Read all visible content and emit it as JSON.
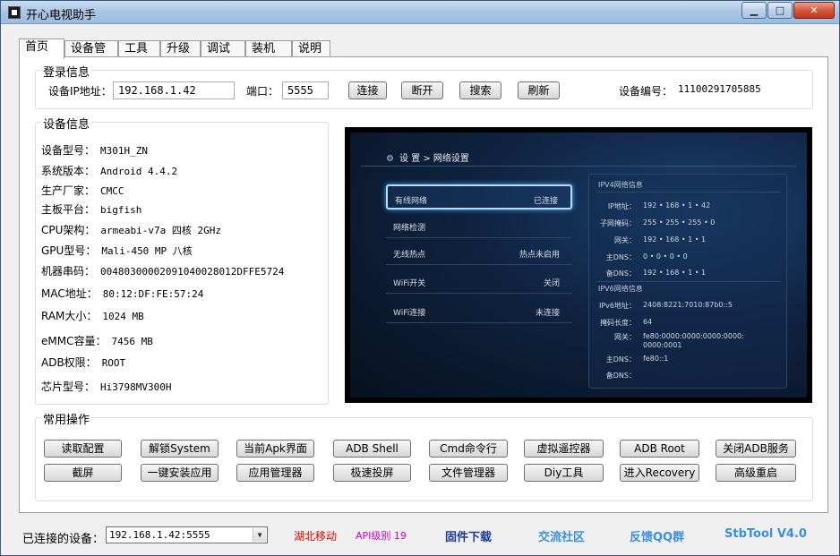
{
  "window": {
    "title": "开心电视助手",
    "min_label": "▁",
    "max_label": "□",
    "close_label": "✕"
  },
  "tabs": [
    {
      "label": "首页"
    },
    {
      "label": "设备管理"
    },
    {
      "label": "工具箱"
    },
    {
      "label": "升级"
    },
    {
      "label": "调试"
    },
    {
      "label": "装机"
    },
    {
      "label": "说明"
    }
  ],
  "login": {
    "group_title": "登录信息",
    "ip_label": "设备IP地址：",
    "ip_value": "192.168.1.42",
    "port_label": "端口：",
    "port_value": "5555",
    "connect": "连接",
    "disconnect": "断开",
    "search": "搜索",
    "refresh": "刷新",
    "device_no_label": "设备编号：",
    "device_no_value": "11100291705885"
  },
  "device_info": {
    "group_title": "设备信息",
    "rows": [
      {
        "k": "设备型号：",
        "v": "M301H_ZN"
      },
      {
        "k": "系统版本：",
        "v": "Android 4.4.2"
      },
      {
        "k": "生产厂家：",
        "v": "CMCC"
      },
      {
        "k": "主板平台：",
        "v": "bigfish"
      },
      {
        "k": "CPU架构：",
        "v": "armeabi-v7a 四核 2GHz"
      },
      {
        "k": "GPU型号：",
        "v": "Mali-450 MP 八核"
      },
      {
        "k": "机器串码：",
        "v": "00480300002091040028012DFFE5724"
      },
      {
        "k": "MAC地址：",
        "v": "80:12:DF:FE:57:24"
      },
      {
        "k": "RAM大小：",
        "v": "1024 MB"
      },
      {
        "k": "eMMC容量：",
        "v": "7456 MB"
      },
      {
        "k": "ADB权限：",
        "v": "ROOT"
      },
      {
        "k": "芯片型号：",
        "v": "Hi3798MV300H"
      }
    ]
  },
  "tv": {
    "breadcrumb": "设 置  >  网络设置",
    "menu": [
      {
        "label": "有线网络",
        "status": "已连接"
      },
      {
        "label": "网络检测",
        "status": ""
      },
      {
        "label": "无线热点",
        "status": "热点未启用"
      },
      {
        "label": "WiFi开关",
        "status": "关闭"
      },
      {
        "label": "WiFi连接",
        "status": "未连接"
      }
    ],
    "ipv4_title": "IPV4网络信息",
    "ipv4": [
      {
        "k": "IP地址：",
        "v": "192  •  168  •  1  •  42"
      },
      {
        "k": "子网掩码：",
        "v": "255  •  255  •  255  •  0"
      },
      {
        "k": "网关：",
        "v": "192  •  168  •  1  •  1"
      },
      {
        "k": "主DNS：",
        "v": "0  •  0  •  0  •  0"
      },
      {
        "k": "备DNS：",
        "v": "192  •  168  •  1  •  1"
      }
    ],
    "ipv6_title": "IPV6网络信息",
    "ipv6": [
      {
        "k": "IPv6地址：",
        "v": "2408:8221:7010:87b0::5"
      },
      {
        "k": "掩码长度：",
        "v": "64"
      },
      {
        "k": "网关：",
        "v": "fe80:0000:0000:0000:0000:"
      },
      {
        "k": "",
        "v": "0000:0001"
      },
      {
        "k": "主DNS：",
        "v": "fe80::1"
      },
      {
        "k": "备DNS：",
        "v": ""
      }
    ]
  },
  "ops": {
    "group_title": "常用操作",
    "row1": [
      "读取配置",
      "解锁System",
      "当前Apk界面",
      "ADB Shell",
      "Cmd命令行",
      "虚拟遥控器",
      "ADB  Root",
      "关闭ADB服务"
    ],
    "row2": [
      "截屏",
      "一键安装应用",
      "应用管理器",
      "极速投屏",
      "文件管理器",
      "Diy工具",
      "进入Recovery",
      "高级重启"
    ]
  },
  "status": {
    "connected_label": "已连接的设备：",
    "connected_value": "192.168.1.42:5555",
    "carrier": "湖北移动",
    "api_level": "API级别 19",
    "firmware_link": "固件下载",
    "community_link": "交流社区",
    "qq_link": "反馈QQ群",
    "version": "StbTool V4.0",
    "colors": {
      "carrier": "#e00000",
      "api": "#d000d0",
      "firmware": "#1a3a9a",
      "links": "#3a8ee6"
    }
  }
}
